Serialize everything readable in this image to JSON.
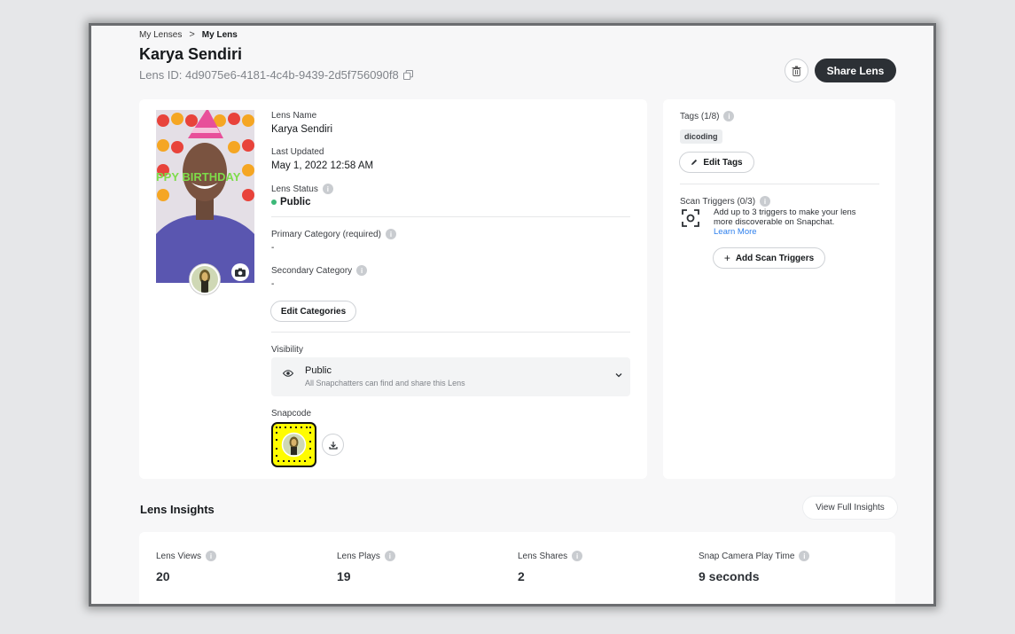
{
  "breadcrumb": {
    "parent": "My Lenses",
    "separator": ">",
    "current": "My Lens"
  },
  "lens": {
    "title": "Karya Sendiri",
    "id_text": "Lens ID: 4d9075e6-4181-4c4b-9439-2d5f756090f8",
    "thumbnail_text": "PPY BIRTHDAY"
  },
  "header_actions": {
    "share_label": "Share Lens",
    "delete_icon": "trash-icon"
  },
  "details": {
    "name_label": "Lens Name",
    "name_value": "Karya Sendiri",
    "updated_label": "Last Updated",
    "updated_value": "May 1, 2022 12:58 AM",
    "status_label": "Lens Status",
    "status_value": "Public",
    "status_color": "#3cb878",
    "primary_label": "Primary Category (required)",
    "primary_value": "-",
    "secondary_label": "Secondary Category",
    "secondary_value": "-",
    "edit_categories_label": "Edit Categories",
    "visibility_label": "Visibility",
    "visibility_value": "Public",
    "visibility_desc": "All Snapchatters can find and share this Lens",
    "snapcode_label": "Snapcode"
  },
  "tags": {
    "heading": "Tags (1/8)",
    "items": [
      "dicoding"
    ],
    "edit_label": "Edit Tags"
  },
  "scan_triggers": {
    "heading": "Scan Triggers (0/3)",
    "description": "Add up to 3 triggers to make your lens more discoverable on Snapchat.",
    "learn_more": "Learn More",
    "add_label": "Add Scan Triggers"
  },
  "insights": {
    "title": "Lens Insights",
    "view_full_label": "View Full Insights",
    "stats": [
      {
        "label": "Lens Views",
        "value": "20"
      },
      {
        "label": "Lens Plays",
        "value": "19"
      },
      {
        "label": "Lens Shares",
        "value": "2"
      },
      {
        "label": "Snap Camera Play Time",
        "value": "9 seconds"
      }
    ]
  },
  "colors": {
    "accent_dark": "#2c3035",
    "snapcode_yellow": "#fffc00",
    "link": "#2f80ed"
  }
}
